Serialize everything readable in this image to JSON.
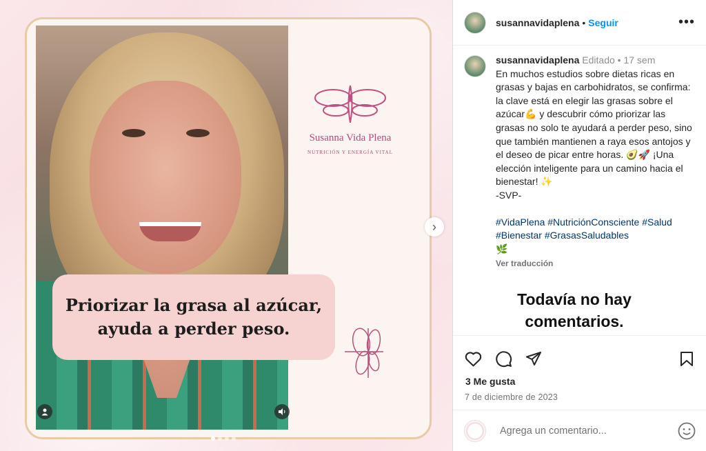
{
  "media": {
    "brand_name": "Susanna Vida Plena",
    "brand_tagline": "NUTRICIÓN Y ENERGÍA VITAL",
    "overlay_line1": "Priorizar la grasa al azúcar,",
    "overlay_line2": "ayuda a perder peso.",
    "next_glyph": "›",
    "carousel_count": 4,
    "carousel_active": 1
  },
  "header": {
    "username": "susannavidaplena",
    "separator": "•",
    "follow_label": "Seguir",
    "more_glyph": "•••"
  },
  "caption": {
    "username": "susannavidaplena",
    "edited": "Editado",
    "separator": "•",
    "age": "17 sem",
    "text": "En muchos estudios sobre dietas ricas en grasas y bajas en carbohidratos, se confirma: la clave está en elegir las grasas sobre el azúcar💪 y descubrir cómo priorizar las grasas no solo te ayudará a perder peso, sino que también mantienen a raya esos antojos y el deseo de picar entre horas. 🥑🚀 ¡Una elección inteligente para un camino hacia el bienestar! ✨\n-SVP-",
    "hashtags": "#VidaPlena #NutriciónConsciente #Salud #Bienestar #GrasasSaludables\n🌿",
    "translate_label": "Ver traducción"
  },
  "comments": {
    "empty_line1": "Todavía no hay",
    "empty_line2": "comentarios."
  },
  "actions": {
    "likes": "3 Me gusta",
    "date": "7 de diciembre de 2023"
  },
  "composer": {
    "placeholder": "Agrega un comentario..."
  },
  "colors": {
    "link_blue": "#0095f6",
    "hashtag": "#00376b",
    "brand_pink": "#b44a78",
    "bubble_pink": "#f6d2d0"
  },
  "icons": [
    "heart-icon",
    "comment-icon",
    "share-icon",
    "bookmark-icon",
    "emoji-icon",
    "user-tag-icon",
    "sound-icon",
    "more-icon"
  ]
}
